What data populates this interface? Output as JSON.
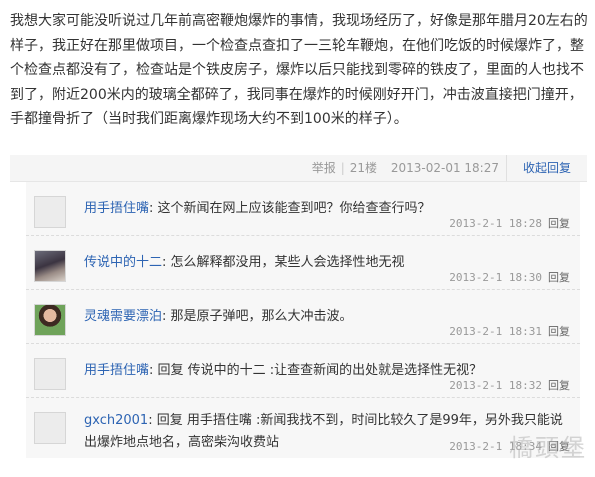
{
  "post": {
    "body": "我想大家可能没听说过几年前高密鞭炮爆炸的事情，我现场经历了，好像是那年腊月20左右的样子，我正好在那里做项目，一个检查点查扣了一三轮车鞭炮，在他们吃饭的时候爆炸了，整个检查点都没有了，检查站是个铁皮房子，爆炸以后只能找到零碎的铁皮了，里面的人也找不到了，附近200米内的玻璃全都碎了，我同事在爆炸的时候刚好开门，冲击波直接把门撞开，手都撞骨折了（当时我们距离爆炸现场大约不到100米的样子）。",
    "report": "举报",
    "floor": "21楼",
    "time": "2013-02-01 18:27",
    "collapse_label": "收起回复"
  },
  "replies": [
    {
      "user": "用手捂住嘴",
      "colon": ":",
      "text": " 这个新闻在网上应该能查到吧？你给查查行吗？",
      "time": "2013-2-1 18:28",
      "reply_label": "回复"
    },
    {
      "user": "传说中的十二",
      "colon": ":",
      "text": " 怎么解释都没用，某些人会选择性地无视",
      "time": "2013-2-1 18:30",
      "reply_label": "回复"
    },
    {
      "user": "灵魂需要漂泊",
      "colon": ":",
      "text": " 那是原子弹吧，那么大冲击波。",
      "time": "2013-2-1 18:31",
      "reply_label": "回复"
    },
    {
      "user": "用手捂住嘴",
      "colon": ":",
      "text": " 回复 传说中的十二 :让查查新闻的出处就是选择性无视？",
      "time": "2013-2-1 18:32",
      "reply_label": "回复"
    },
    {
      "user": "gxch2001",
      "colon": ":",
      "text": " 回复 用手捂住嘴 :新闻我找不到，时间比较久了是99年，另外我只能说出爆炸地点地名，高密柴沟收费站",
      "time": "2013-2-1 18:34",
      "reply_label": "回复"
    }
  ],
  "watermark": "橋頭堡"
}
